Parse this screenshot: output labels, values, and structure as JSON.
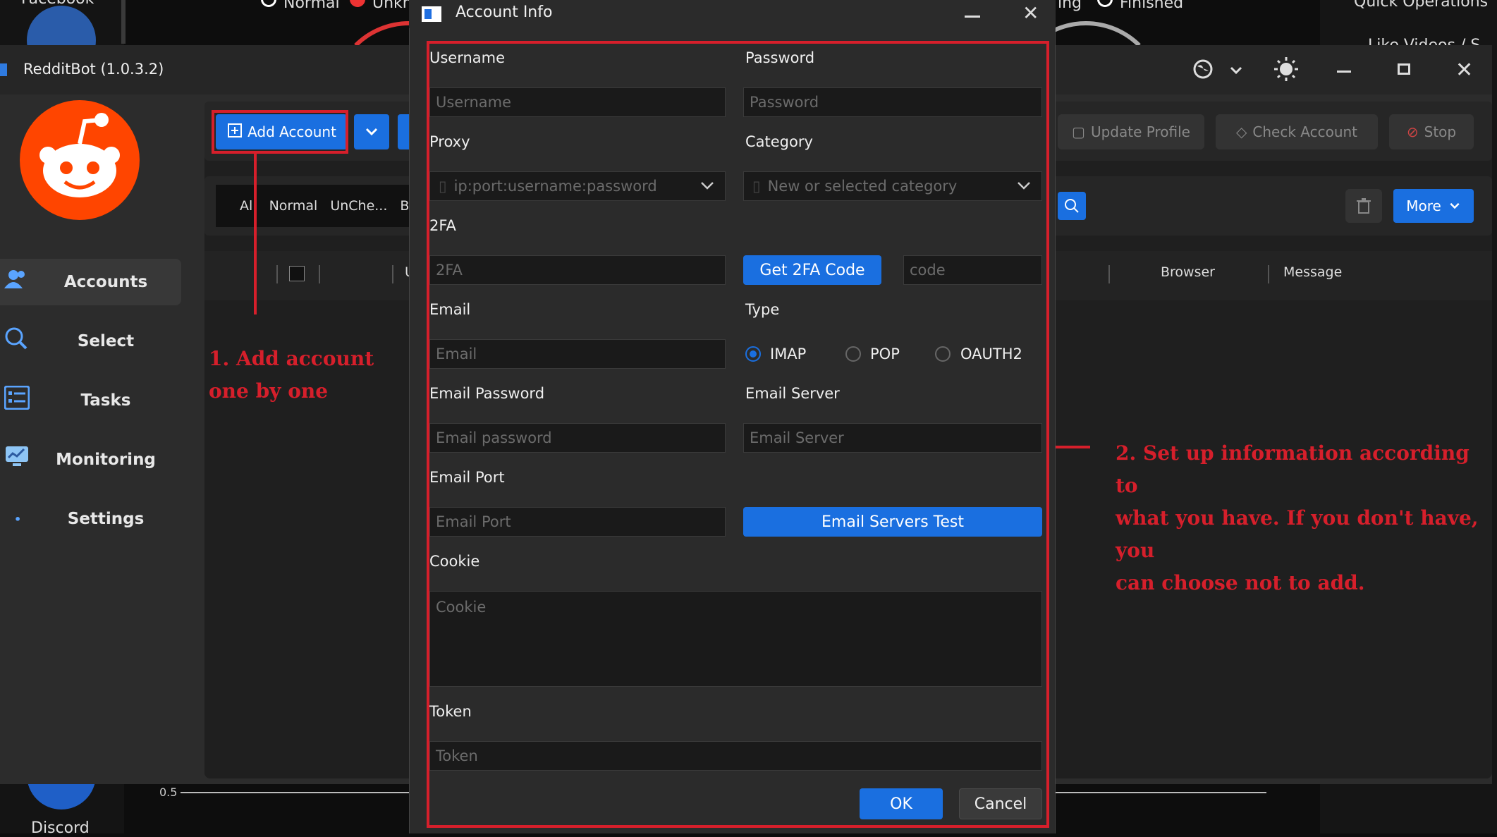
{
  "background": {
    "facebook_label": "Facebook",
    "discord_label": "Discord",
    "top_status": [
      "Normal",
      "Unkn",
      "ing",
      "Finished"
    ],
    "right_panel": {
      "quick_operations": "Quick Operations",
      "like_videos": "Like Videos / S"
    },
    "axis_label": "0.5"
  },
  "main_window": {
    "title": "RedditBot (1.0.3.2)",
    "sidebar": [
      {
        "label": "Accounts",
        "icon": "accounts-icon"
      },
      {
        "label": "Select",
        "icon": "search-icon"
      },
      {
        "label": "Tasks",
        "icon": "tasks-icon"
      },
      {
        "label": "Monitoring",
        "icon": "monitoring-icon"
      },
      {
        "label": "Settings",
        "icon": "settings-icon"
      }
    ],
    "toolbar": {
      "add_account": "Add Account",
      "update_profile": "Update Profile",
      "check_account": "Check Account",
      "stop": "Stop"
    },
    "filters": {
      "all": "All",
      "normal": "Normal",
      "unchecked": "UnChe...",
      "blocked": "Blo"
    },
    "more_button": "More",
    "table_headers": {
      "u": "U",
      "browser": "Browser",
      "message": "Message"
    }
  },
  "annotations": {
    "step1": [
      "1. Add account",
      "one by one"
    ],
    "step2": [
      "2. Set up information according to",
      "what you have. If you don't have, you",
      "can choose not to add."
    ]
  },
  "dialog": {
    "title": "Account Info",
    "username": {
      "label": "Username",
      "placeholder": "Username"
    },
    "password": {
      "label": "Password",
      "placeholder": "Password"
    },
    "proxy": {
      "label": "Proxy",
      "placeholder": "ip:port:username:password"
    },
    "category": {
      "label": "Category",
      "placeholder": "New or selected category"
    },
    "twofa": {
      "label": "2FA",
      "placeholder": "2FA",
      "button": "Get 2FA Code",
      "code_placeholder": "code"
    },
    "email": {
      "label": "Email",
      "placeholder": "Email"
    },
    "type": {
      "label": "Type",
      "options": [
        "IMAP",
        "POP",
        "OAUTH2"
      ],
      "selected": "IMAP"
    },
    "email_password": {
      "label": "Email Password",
      "placeholder": "Email password"
    },
    "email_server": {
      "label": "Email Server",
      "placeholder": "Email Server"
    },
    "email_port": {
      "label": "Email Port",
      "placeholder": "Email Port"
    },
    "test_button": "Email Servers Test",
    "cookie": {
      "label": "Cookie",
      "placeholder": "Cookie"
    },
    "token": {
      "label": "Token",
      "placeholder": "Token"
    },
    "ok": "OK",
    "cancel": "Cancel"
  },
  "colors": {
    "accent": "#1a6fe0",
    "annotation": "#d61f2b",
    "reddit": "#ff4500"
  }
}
